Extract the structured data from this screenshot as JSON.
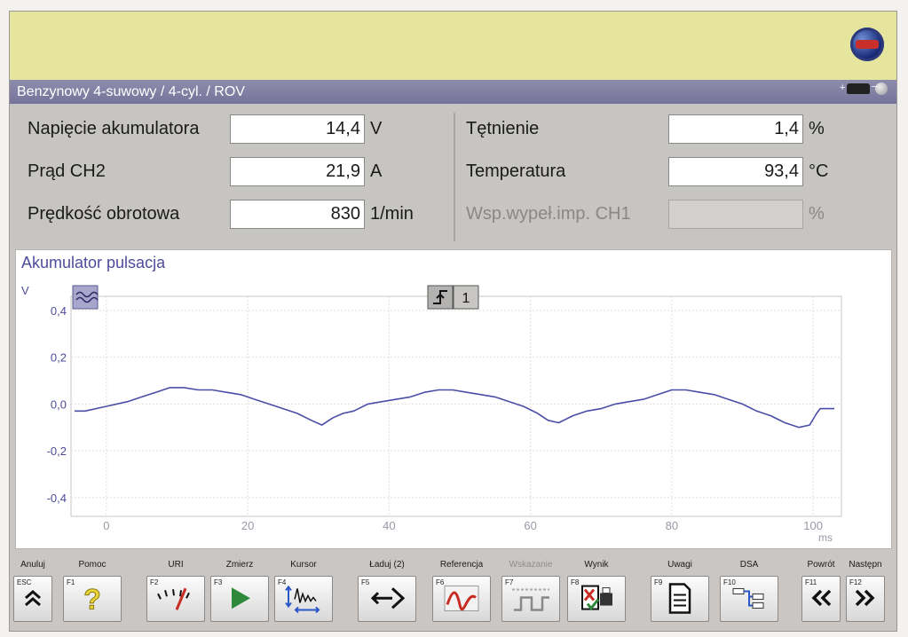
{
  "header": {
    "title": "Benzynowy 4-suwowy /  4-cyl. / ROV"
  },
  "measurements": {
    "left": [
      {
        "label": "Napięcie akumulatora",
        "value": "14,4",
        "unit": "V"
      },
      {
        "label": "Prąd CH2",
        "value": "21,9",
        "unit": "A"
      },
      {
        "label": "Prędkość obrotowa",
        "value": "830",
        "unit": "1/min"
      }
    ],
    "right": [
      {
        "label": "Tętnienie",
        "value": "1,4",
        "unit": "%"
      },
      {
        "label": "Temperatura",
        "value": "93,4",
        "unit": "°C"
      },
      {
        "label": "Wsp.wypeł.imp. CH1",
        "value": "",
        "unit": "%"
      }
    ]
  },
  "chart": {
    "title": "Akumulator pulsacja",
    "channel_badge": "1"
  },
  "chart_data": {
    "type": "line",
    "ylabel": "V",
    "xlabel": "ms",
    "xlim": [
      -5,
      104
    ],
    "ylim": [
      -0.48,
      0.46
    ],
    "yticks": [
      "0,4",
      "0,2",
      "0,0",
      "-0,2",
      "-0,4"
    ],
    "ytick_values": [
      0.4,
      0.2,
      0.0,
      -0.2,
      -0.4
    ],
    "xticks": [
      "0",
      "20",
      "40",
      "60",
      "80",
      "100"
    ],
    "xtick_values": [
      0,
      20,
      40,
      60,
      80,
      100
    ],
    "grid": true,
    "series": [
      {
        "color": "#4a4ea6",
        "x": [
          -4.5,
          -3,
          0,
          3,
          5,
          7,
          9,
          11,
          13,
          15,
          17,
          19,
          21,
          23,
          25,
          27,
          29,
          30.5,
          32,
          33.5,
          35,
          37,
          39,
          41,
          43,
          45,
          47,
          49,
          51,
          53,
          55,
          57,
          59,
          61,
          62.5,
          64,
          66,
          68,
          70,
          72,
          74,
          76,
          78,
          80,
          82,
          84,
          86,
          88,
          90,
          92,
          94,
          96,
          98,
          99.5,
          100.5,
          101,
          102,
          103
        ],
        "y": [
          -0.03,
          -0.03,
          -0.01,
          0.01,
          0.03,
          0.05,
          0.07,
          0.07,
          0.06,
          0.06,
          0.05,
          0.04,
          0.02,
          0.0,
          -0.02,
          -0.04,
          -0.07,
          -0.09,
          -0.06,
          -0.04,
          -0.03,
          0.0,
          0.01,
          0.02,
          0.03,
          0.05,
          0.06,
          0.06,
          0.05,
          0.04,
          0.03,
          0.01,
          -0.01,
          -0.04,
          -0.07,
          -0.08,
          -0.05,
          -0.03,
          -0.02,
          0.0,
          0.01,
          0.02,
          0.04,
          0.06,
          0.06,
          0.05,
          0.04,
          0.02,
          0.0,
          -0.03,
          -0.05,
          -0.08,
          -0.1,
          -0.09,
          -0.04,
          -0.02,
          -0.02,
          -0.02
        ]
      }
    ]
  },
  "function_keys": [
    {
      "id": "esc",
      "label": "Anuluj",
      "key": "ESC",
      "icon": "double-chevron-up-icon",
      "enabled": true
    },
    {
      "id": "f1",
      "label": "Pomoc",
      "key": "F1",
      "icon": "question-mark-icon",
      "enabled": true
    },
    {
      "id": "f2",
      "label": "URI",
      "key": "F2",
      "icon": "gauge-needle-icon",
      "enabled": true
    },
    {
      "id": "f3",
      "label": "Zmierz",
      "key": "F3",
      "icon": "play-icon",
      "enabled": true
    },
    {
      "id": "f4",
      "label": "Kursor",
      "key": "F4",
      "icon": "waveform-cursor-icon",
      "enabled": true
    },
    {
      "id": "f5",
      "label": "Ładuj (2)",
      "key": "F5",
      "icon": "load-arrow-icon",
      "enabled": true
    },
    {
      "id": "f6",
      "label": "Referencja",
      "key": "F6",
      "icon": "reference-wave-icon",
      "enabled": true
    },
    {
      "id": "f7",
      "label": "Wskazanie",
      "key": "F7",
      "icon": "square-wave-icon",
      "enabled": false
    },
    {
      "id": "f8",
      "label": "Wynik",
      "key": "F8",
      "icon": "result-printer-icon",
      "enabled": true
    },
    {
      "id": "f9",
      "label": "Uwagi",
      "key": "F9",
      "icon": "document-icon",
      "enabled": true
    },
    {
      "id": "f10",
      "label": "DSA",
      "key": "F10",
      "icon": "dsa-tree-icon",
      "enabled": true
    },
    {
      "id": "f11",
      "label": "Powrót",
      "key": "F11",
      "icon": "double-chevron-left-icon",
      "enabled": true
    },
    {
      "id": "f12",
      "label": "Następn",
      "key": "F12",
      "icon": "double-chevron-right-icon",
      "enabled": true
    }
  ]
}
